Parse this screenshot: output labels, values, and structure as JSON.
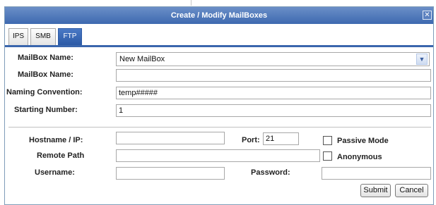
{
  "window": {
    "title": "Create / Modify MailBoxes",
    "close_glyph": "✕"
  },
  "tabs": [
    {
      "label": "IPS",
      "active": false
    },
    {
      "label": "SMB",
      "active": false
    },
    {
      "label": "FTP",
      "active": true
    }
  ],
  "mailbox": {
    "select_label": "MailBox Name:",
    "select_value": "New MailBox",
    "name_label": "MailBox Name:",
    "name_value": "",
    "convention_label": "Naming Convention:",
    "convention_value": "temp#####",
    "start_label": "Starting Number:",
    "start_value": "1"
  },
  "ftp": {
    "host_label": "Hostname / IP:",
    "host_value": "",
    "port_label": "Port:",
    "port_value": "21",
    "passive_label": "Passive Mode",
    "passive_checked": false,
    "path_label": "Remote Path",
    "path_value": "",
    "anonymous_label": "Anonymous",
    "anonymous_checked": false,
    "user_label": "Username:",
    "user_value": "",
    "password_label": "Password:",
    "password_value": ""
  },
  "buttons": {
    "submit": "Submit",
    "cancel": "Cancel"
  },
  "colors": {
    "titlebar": "#3d69b0",
    "active_tab": "#2c5aa6",
    "divider": "#c0c0c0"
  },
  "icons": {
    "close": "close-icon",
    "dropdown": "chevron-down-icon"
  }
}
